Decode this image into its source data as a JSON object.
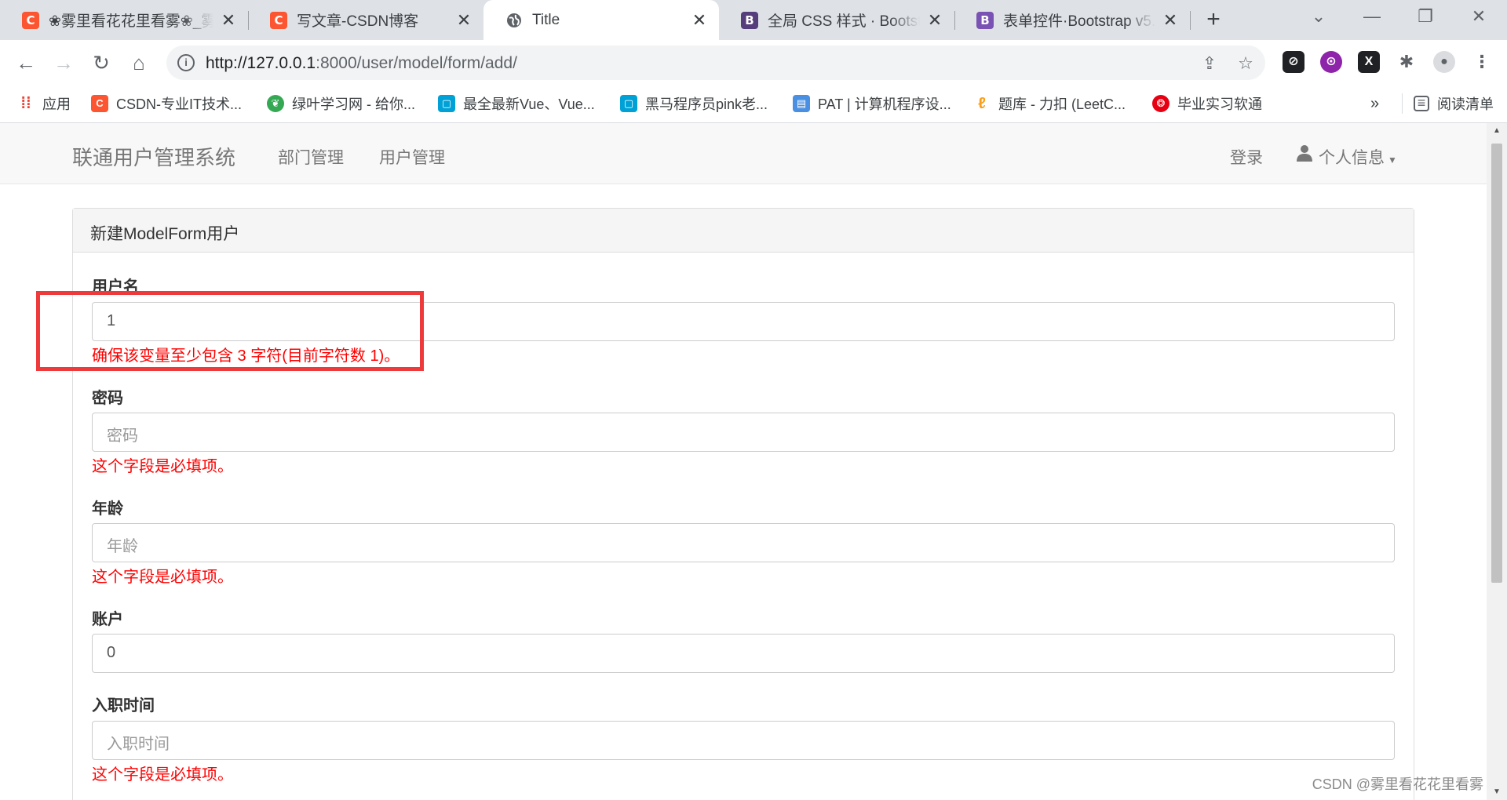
{
  "browser": {
    "tabs": [
      {
        "title": "❀雾里看花花里看雾❀_雾",
        "favicon": "C",
        "color": "#fc5531"
      },
      {
        "title": "写文章-CSDN博客",
        "favicon": "C",
        "color": "#fc5531"
      },
      {
        "title": "Title",
        "favicon": "globe-icon",
        "color": "#5f6368"
      },
      {
        "title": "全局 CSS 样式 · Bootstrap",
        "favicon": "B",
        "color": "#563d7c"
      },
      {
        "title": "表单控件·Bootstrap v5.1",
        "favicon": "B",
        "color": "#7952b3"
      }
    ],
    "new_tab": "+",
    "url_host": "http://127.0.0.1",
    "url_path": ":8000/user/model/form/add/",
    "bookmarks": [
      {
        "label": "应用",
        "color": "#ea4335"
      },
      {
        "label": "CSDN-专业IT技术...",
        "color": "#fc5531"
      },
      {
        "label": "绿叶学习网 - 给你...",
        "color": "#34a853"
      },
      {
        "label": "最全最新Vue、Vue...",
        "color": "#00a1d6"
      },
      {
        "label": "黑马程序员pink老...",
        "color": "#00a1d6"
      },
      {
        "label": "PAT | 计算机程序设...",
        "color": "#4a90e2"
      },
      {
        "label": "题库 - 力扣 (LeetC...",
        "color": "#f89f1b"
      },
      {
        "label": "毕业实习软通",
        "color": "#e60012"
      }
    ],
    "more_bookmarks": "»",
    "reading_list": "阅读清单"
  },
  "navbar": {
    "brand": "联通用户管理系统",
    "links": [
      "部门管理",
      "用户管理"
    ],
    "login": "登录",
    "user_menu": "个人信息"
  },
  "panel": {
    "heading": "新建ModelForm用户"
  },
  "form": {
    "username": {
      "label": "用户名",
      "value": "1",
      "error": "确保该变量至少包含 3 字符(目前字符数 1)。"
    },
    "password": {
      "label": "密码",
      "placeholder": "密码",
      "error": "这个字段是必填项。"
    },
    "age": {
      "label": "年龄",
      "placeholder": "年龄",
      "error": "这个字段是必填项。"
    },
    "account": {
      "label": "账户",
      "value": "0"
    },
    "create_time": {
      "label": "入职时间",
      "placeholder": "入职时间",
      "error": "这个字段是必填项。"
    }
  },
  "watermark": "CSDN @雾里看花花里看雾",
  "colors": {
    "error": "#ff0000",
    "highlight": "#ee3a3a",
    "navbar_bg": "#f8f8f8"
  }
}
